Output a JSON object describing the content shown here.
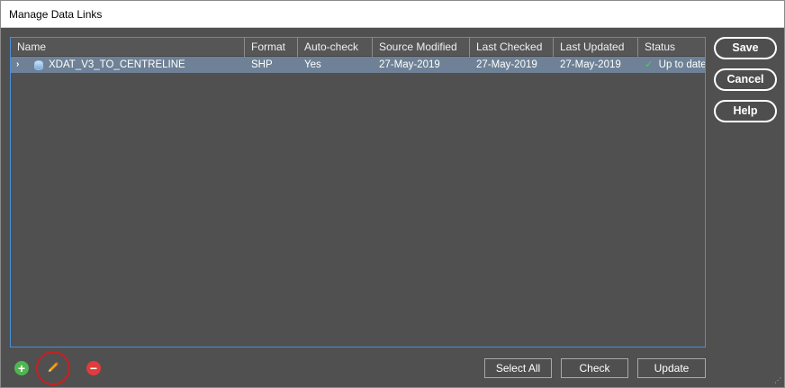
{
  "window": {
    "title": "Manage Data Links"
  },
  "grid": {
    "columns": [
      "Name",
      "Format",
      "Auto-check",
      "Source Modified",
      "Last Checked",
      "Last Updated",
      "Status"
    ],
    "rows": [
      {
        "expander": "›",
        "name": "XDAT_V3_TO_CENTRELINE",
        "format": "SHP",
        "auto_check": "Yes",
        "source_modified": "27-May-2019",
        "last_checked": "27-May-2019",
        "last_updated": "27-May-2019",
        "status": "Up to date",
        "status_icon": "check-icon"
      }
    ]
  },
  "side_buttons": {
    "save": "Save",
    "cancel": "Cancel",
    "help": "Help"
  },
  "toolbar": {
    "add_icon": "+",
    "remove_icon": "−"
  },
  "bottom_buttons": {
    "select_all": "Select All",
    "check": "Check",
    "update": "Update"
  },
  "colors": {
    "selection": "#6e8196",
    "status_ok": "#55c26d",
    "add": "#4fb64f",
    "remove": "#e23b3b",
    "highlight_circle": "#cc1f1f"
  }
}
